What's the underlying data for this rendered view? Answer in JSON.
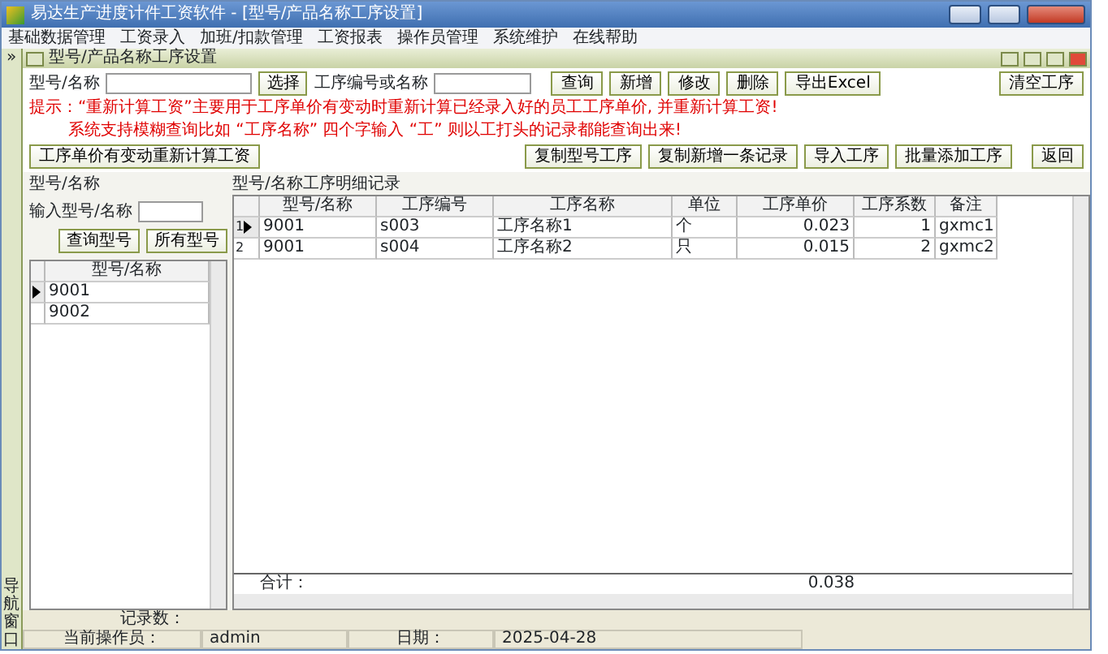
{
  "window": {
    "title": "易达生产进度计件工资软件  - [型号/产品名称工序设置]"
  },
  "menu": [
    "基础数据管理",
    "工资录入",
    "加班/扣款管理",
    "工资报表",
    "操作员管理",
    "系统维护",
    "在线帮助"
  ],
  "nav_strip": {
    "toggle": "»",
    "label": "导航窗口"
  },
  "child_window": {
    "title": "型号/产品名称工序设置"
  },
  "search": {
    "model_label": "型号/名称",
    "select_button": "选择",
    "process_label": "工序编号或名称"
  },
  "buttons_top": [
    "查询",
    "新增",
    "修改",
    "删除",
    "导出Excel"
  ],
  "clear_button": "清空工序",
  "hint": {
    "lead": "提示：",
    "line1": "“重新计算工资”主要用于工序单价有变动时重新计算已经录入好的员工工序单价, 并重新计算工资!",
    "line2": "系统支持模糊查询比如 “工序名称” 四个字输入 “工” 则以工打头的记录都能查询出来!"
  },
  "recalc_button": "工序单价有变动重新计算工资",
  "return_button": "返回",
  "buttons_bottom": [
    "复制型号工序",
    "复制新增一条记录",
    "导入工序",
    "批量添加工序"
  ],
  "left_panel": {
    "title": "型号/名称",
    "input_label": "输入型号/名称",
    "query_button": "查询型号",
    "all_button": "所有型号",
    "column": "型号/名称",
    "rows": [
      {
        "value": "9001",
        "selected": true
      },
      {
        "value": "9002",
        "selected": false
      }
    ]
  },
  "grid": {
    "title": "型号/名称工序明细记录",
    "columns": [
      "型号/名称",
      "工序编号",
      "工序名称",
      "单位",
      "工序单价",
      "工序系数",
      "备注"
    ],
    "rows": [
      {
        "number": "1",
        "selected": true,
        "cells": [
          "9001",
          "s003",
          "工序名称1",
          "个",
          "0.023",
          "1",
          "gxmc1"
        ]
      },
      {
        "number": "2",
        "selected": false,
        "cells": [
          "9001",
          "s004",
          "工序名称2",
          "只",
          "0.015",
          "2",
          "gxmc2"
        ]
      }
    ],
    "total_label": "合计：",
    "total_value": "0.038"
  },
  "record_count_label": "记录数：",
  "status_bar": {
    "operator_label": "当前操作员：",
    "operator": "admin",
    "date_label": "日期：",
    "date": "2025-04-28"
  }
}
